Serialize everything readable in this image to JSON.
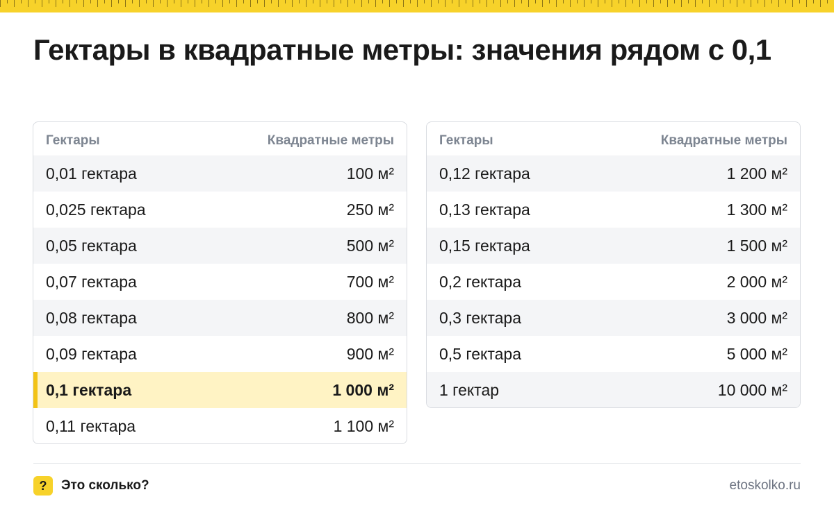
{
  "title": "Гектары в квадратные метры: значения рядом с 0,1",
  "colors": {
    "accent": "#f7d22a",
    "highlight_bg": "#fff3c4",
    "highlight_bar": "#f2c316",
    "stripe": "#f4f5f7"
  },
  "tables": [
    {
      "headers": [
        "Гектары",
        "Квадратные метры"
      ],
      "rows": [
        [
          "0,01 гектара",
          "100 м²"
        ],
        [
          "0,025 гектара",
          "250 м²"
        ],
        [
          "0,05 гектара",
          "500 м²"
        ],
        [
          "0,07 гектара",
          "700 м²"
        ],
        [
          "0,08 гектара",
          "800 м²"
        ],
        [
          "0,09 гектара",
          "900 м²"
        ],
        [
          "0,1 гектара",
          "1 000 м²"
        ],
        [
          "0,11 гектара",
          "1 100 м²"
        ]
      ],
      "highlight_row": 6
    },
    {
      "headers": [
        "Гектары",
        "Квадратные метры"
      ],
      "rows": [
        [
          "0,12 гектара",
          "1 200 м²"
        ],
        [
          "0,13 гектара",
          "1 300 м²"
        ],
        [
          "0,15 гектара",
          "1 500 м²"
        ],
        [
          "0,2 гектара",
          "2 000 м²"
        ],
        [
          "0,3 гектара",
          "3 000 м²"
        ],
        [
          "0,5 гектара",
          "5 000 м²"
        ],
        [
          "1 гектар",
          "10 000 м²"
        ]
      ]
    }
  ],
  "footer": {
    "badge": "?",
    "badge_icon": "question-icon",
    "name": "Это сколько?",
    "site": "etoskolko.ru"
  }
}
